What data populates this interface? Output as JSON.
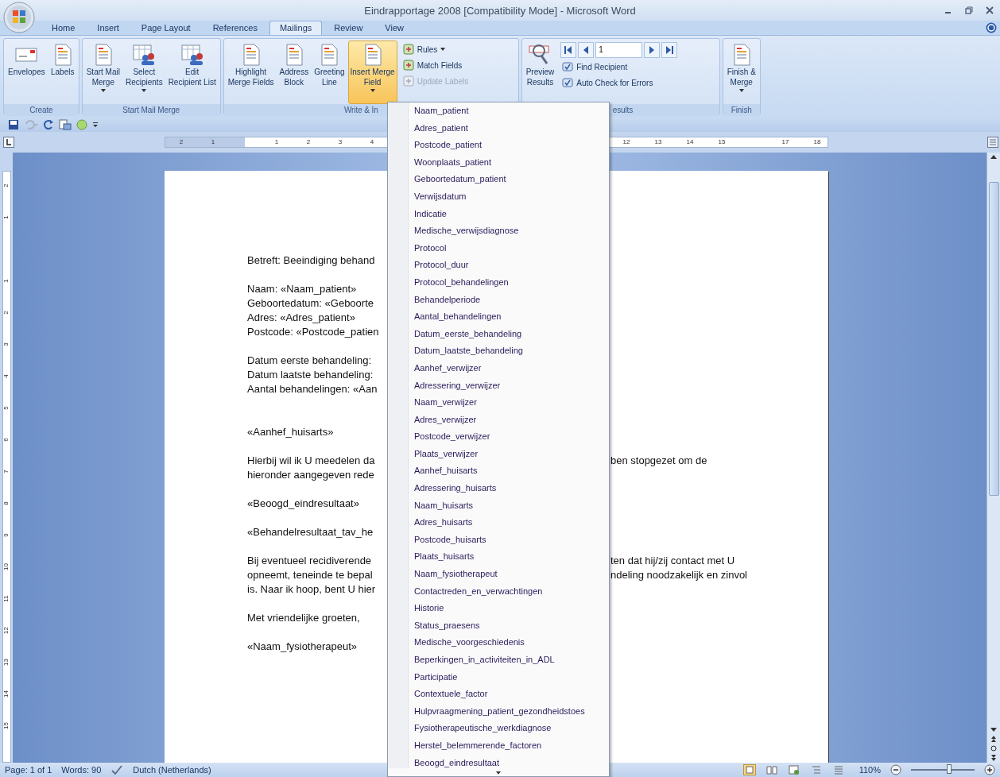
{
  "window": {
    "title": "Eindrapportage 2008 [Compatibility Mode] - Microsoft Word"
  },
  "tabs": [
    {
      "label": "Home",
      "selected": false
    },
    {
      "label": "Insert",
      "selected": false
    },
    {
      "label": "Page Layout",
      "selected": false
    },
    {
      "label": "References",
      "selected": false
    },
    {
      "label": "Mailings",
      "selected": true
    },
    {
      "label": "Review",
      "selected": false
    },
    {
      "label": "View",
      "selected": false
    }
  ],
  "ribbon": {
    "groups": [
      {
        "label": "Create",
        "items": [
          {
            "kind": "large",
            "lines": [
              "Envelopes"
            ],
            "menu": false,
            "pressed": false
          },
          {
            "kind": "large",
            "lines": [
              "Labels"
            ],
            "menu": false,
            "pressed": false
          }
        ]
      },
      {
        "label": "Start Mail Merge",
        "items": [
          {
            "kind": "large",
            "lines": [
              "Start Mail",
              "Merge"
            ],
            "menu": true,
            "pressed": false
          },
          {
            "kind": "large",
            "lines": [
              "Select",
              "Recipients"
            ],
            "menu": true,
            "pressed": false
          },
          {
            "kind": "large",
            "lines": [
              "Edit",
              "Recipient List"
            ],
            "menu": false,
            "pressed": false
          }
        ]
      },
      {
        "label": "Write & In",
        "items": [
          {
            "kind": "large",
            "lines": [
              "Highlight",
              "Merge Fields"
            ],
            "menu": false,
            "pressed": false
          },
          {
            "kind": "large",
            "lines": [
              "Address",
              "Block"
            ],
            "menu": false,
            "pressed": false
          },
          {
            "kind": "large",
            "lines": [
              "Greeting",
              "Line"
            ],
            "menu": false,
            "pressed": false
          },
          {
            "kind": "large",
            "lines": [
              "Insert Merge",
              "Field"
            ],
            "menu": true,
            "pressed": true
          },
          {
            "kind": "small",
            "buttons": [
              {
                "label": "Rules",
                "menu": true,
                "disabled": false
              },
              {
                "label": "Match Fields",
                "menu": false,
                "disabled": false
              },
              {
                "label": "Update Labels",
                "menu": false,
                "disabled": true
              }
            ]
          }
        ]
      },
      {
        "label": "esults",
        "items": [
          {
            "kind": "large",
            "lines": [
              "Preview",
              "Results"
            ],
            "menu": false,
            "pressed": false
          },
          {
            "kind": "nav",
            "value": "1",
            "buttons": [
              {
                "label": "Find Recipient",
                "menu": false,
                "disabled": false
              },
              {
                "label": "Auto Check for Errors",
                "menu": false,
                "disabled": false
              }
            ]
          }
        ]
      },
      {
        "label": "Finish",
        "items": [
          {
            "kind": "large",
            "lines": [
              "Finish &",
              "Merge"
            ],
            "menu": true,
            "pressed": false
          }
        ]
      }
    ]
  },
  "ruler": {
    "top_numbers": [
      "2",
      "1",
      "1",
      "2",
      "3",
      "4",
      "12",
      "13",
      "14",
      "15",
      "17",
      "18"
    ],
    "side_numbers": [
      "2",
      "1",
      "1",
      "2",
      "3",
      "4",
      "5",
      "6",
      "7",
      "8",
      "9",
      "10",
      "11",
      "12",
      "13",
      "14",
      "15"
    ]
  },
  "document": {
    "paragraphs": [
      {
        "lines": [
          {
            "left": "Betreft: Beeindiging behand"
          }
        ]
      },
      {
        "lines": [
          {
            "left": "Naam: «Naam_patient»"
          },
          {
            "left": "Geboortedatum: «Geboorte"
          },
          {
            "left": "Adres: «Adres_patient»"
          },
          {
            "left": "Postcode: «Postcode_patien"
          }
        ]
      },
      {
        "lines": [
          {
            "left": "Datum eerste behandeling:"
          },
          {
            "left": "Datum laatste behandeling:"
          },
          {
            "left": "Aantal behandelingen: «Aan"
          }
        ]
      },
      {
        "lines": [
          {
            "left": "«Aanhef_huisarts»"
          }
        ]
      },
      {
        "lines": [
          {
            "left": "Hierbij wil ik U meedelen da",
            "right": "ben stopgezet om de"
          },
          {
            "left": "hieronder aangegeven rede"
          }
        ]
      },
      {
        "lines": [
          {
            "left": "«Beoogd_eindresultaat»"
          }
        ]
      },
      {
        "lines": [
          {
            "left": "«Behandelresultaat_tav_he"
          }
        ]
      },
      {
        "lines": [
          {
            "left": "Bij eventueel recidiverende",
            "right": "ten dat hij/zij contact met U"
          },
          {
            "left": "opneemt, teneinde te bepal",
            "right": "ndeling noodzakelijk en zinvol"
          },
          {
            "left": "is. Naar ik hoop, bent U hier"
          }
        ]
      },
      {
        "lines": [
          {
            "left": "Met vriendelijke groeten,"
          }
        ]
      },
      {
        "lines": [
          {
            "left": "«Naam_fysiotherapeut»"
          }
        ]
      }
    ]
  },
  "merge_field_menu": {
    "items": [
      "Naam_patient",
      "Adres_patient",
      "Postcode_patient",
      "Woonplaats_patient",
      "Geboortedatum_patient",
      "Verwijsdatum",
      "Indicatie",
      "Medische_verwijsdiagnose",
      "Protocol",
      "Protocol_duur",
      "Protocol_behandelingen",
      "Behandelperiode",
      "Aantal_behandelingen",
      "Datum_eerste_behandeling",
      "Datum_laatste_behandeling",
      "Aanhef_verwijzer",
      "Adressering_verwijzer",
      "Naam_verwijzer",
      "Adres_verwijzer",
      "Postcode_verwijzer",
      "Plaats_verwijzer",
      "Aanhef_huisarts",
      "Adressering_huisarts",
      "Naam_huisarts",
      "Adres_huisarts",
      "Postcode_huisarts",
      "Plaats_huisarts",
      "Naam_fysiotherapeut",
      "Contactreden_en_verwachtingen",
      "Historie",
      "Status_praesens",
      "Medische_voorgeschiedenis",
      "Beperkingen_in_activiteiten_in_ADL",
      "Participatie",
      "Contextuele_factor",
      "Hulpvraagmening_patient_gezondheidstoes",
      "Fysiotherapeutische_werkdiagnose",
      "Herstel_belemmerende_factoren",
      "Beoogd_eindresultaat"
    ]
  },
  "status_bar": {
    "page": "Page: 1 of 1",
    "words": "Words: 90",
    "language": "Dutch (Netherlands)",
    "zoom": "110%",
    "zoom_slider": {
      "level": 0.6
    }
  }
}
